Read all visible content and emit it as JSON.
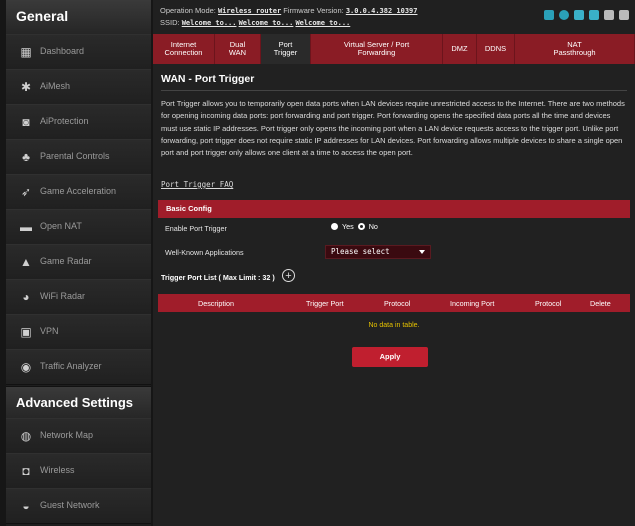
{
  "sidebar": {
    "header": "General",
    "items": [
      {
        "label": "Dashboard",
        "icon": "dashboard-icon",
        "glyph": "▦"
      },
      {
        "label": "AiMesh",
        "icon": "aimesh-icon",
        "glyph": "✱"
      },
      {
        "label": "AiProtection",
        "icon": "shield-icon",
        "glyph": "◙"
      },
      {
        "label": "Parental Controls",
        "icon": "family-icon",
        "glyph": "♣"
      },
      {
        "label": "Game Acceleration",
        "icon": "rocket-icon",
        "glyph": "➶"
      },
      {
        "label": "Open NAT",
        "icon": "nat-icon",
        "glyph": "▬"
      },
      {
        "label": "Game Radar",
        "icon": "radar-icon",
        "glyph": "▲"
      },
      {
        "label": "WiFi Radar",
        "icon": "wifi-radar-icon",
        "glyph": "◕"
      },
      {
        "label": "VPN",
        "icon": "vpn-icon",
        "glyph": "▣"
      },
      {
        "label": "Traffic Analyzer",
        "icon": "traffic-analyzer-icon",
        "glyph": "◉"
      }
    ],
    "advanced_header": "Advanced Settings",
    "advanced_items": [
      {
        "label": "Network Map",
        "icon": "network-map-icon",
        "glyph": "◍"
      },
      {
        "label": "Wireless",
        "icon": "wireless-icon",
        "glyph": "◘"
      },
      {
        "label": "Guest Network",
        "icon": "guest-network-icon",
        "glyph": "◒"
      }
    ]
  },
  "topbar": {
    "operation_mode_label": "Operation Mode:",
    "operation_mode_value": "Wireless router",
    "firmware_label": "Firmware Version:",
    "firmware_value": "3.0.0.4.382_10397",
    "ssid_label": "SSID:",
    "ssid_values": [
      "Welcome to...",
      "Welcome to...",
      "Welcome to..."
    ],
    "status_colors": [
      "#2aa0b8",
      "#2aa0b8",
      "#3ab0c8",
      "#3ab0c8",
      "#bbbbbb",
      "#bbbbbb"
    ]
  },
  "tabs": [
    {
      "line1": "Internet",
      "line2": "Connection"
    },
    {
      "line1": "Dual",
      "line2": "WAN"
    },
    {
      "line1": "Port",
      "line2": "Trigger"
    },
    {
      "line1": "Virtual Server / Port",
      "line2": "Forwarding"
    },
    {
      "line1": "DMZ",
      "line2": ""
    },
    {
      "line1": "DDNS",
      "line2": ""
    },
    {
      "line1": "NAT",
      "line2": "Passthrough"
    }
  ],
  "page": {
    "title": "WAN - Port Trigger",
    "description": "Port Trigger allows you to temporarily open data ports when LAN devices require unrestricted access to the Internet. There are two methods for opening incoming data ports: port forwarding and port trigger. Port forwarding opens the specified data ports all the time and devices must use static IP addresses. Port trigger only opens the incoming port when a LAN device requests access to the trigger port. Unlike port forwarding, port trigger does not require static IP addresses for LAN devices. Port forwarding allows multiple devices to share a single open port and port trigger only allows one client at a time to access the open port.",
    "faq_link": "Port Trigger FAQ"
  },
  "basic_config": {
    "title": "Basic Config",
    "enable_label": "Enable Port Trigger",
    "yes_label": "Yes",
    "no_label": "No",
    "enabled": "No",
    "apps_label": "Well-Known Applications",
    "apps_value": "Please select"
  },
  "trigger_list": {
    "title": "Trigger Port List ( Max Limit : 32 )",
    "columns": [
      "Description",
      "Trigger Port",
      "Protocol",
      "Incoming Port",
      "Protocol",
      "Delete"
    ],
    "empty_text": "No data in table.",
    "apply_label": "Apply"
  },
  "colors": {
    "accent": "#a01d2a",
    "no_data": "#e6c200"
  }
}
